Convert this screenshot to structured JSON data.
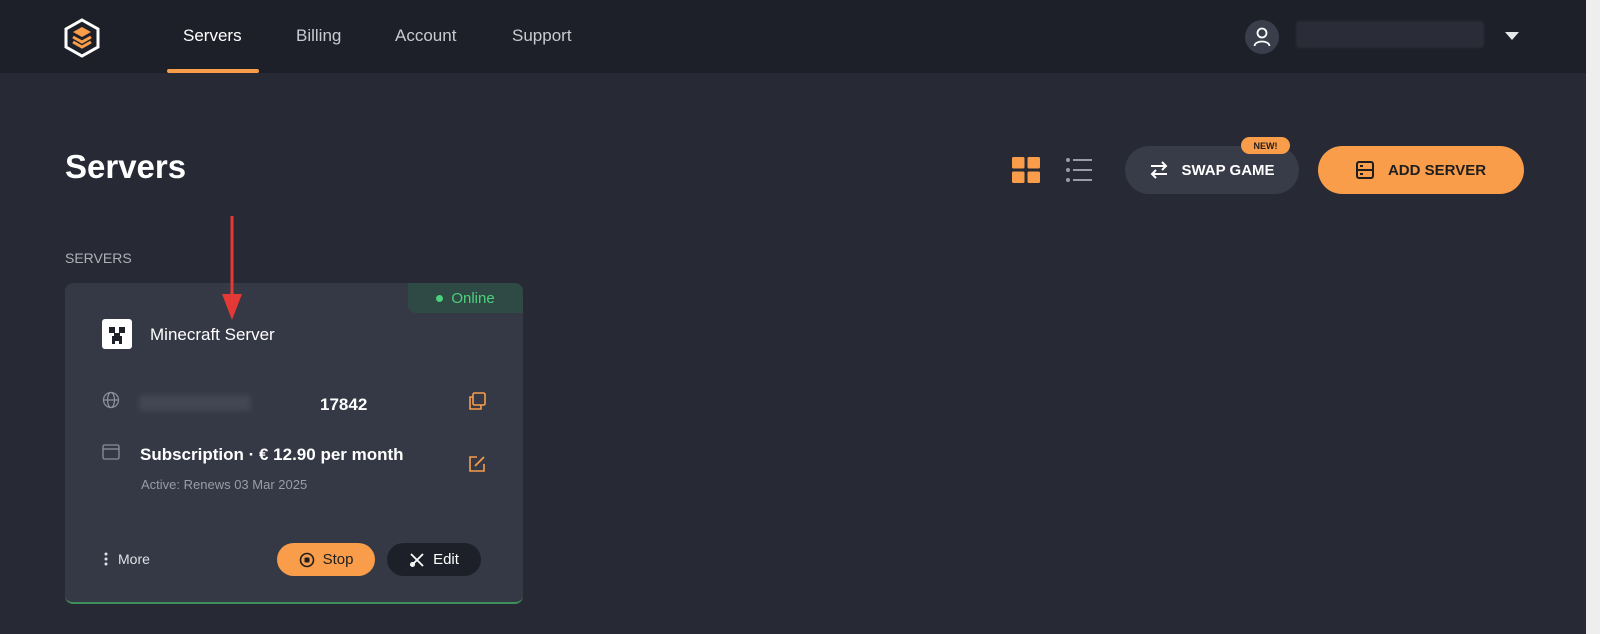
{
  "nav": {
    "items": [
      {
        "label": "Servers",
        "active": true
      },
      {
        "label": "Billing"
      },
      {
        "label": "Account"
      },
      {
        "label": "Support"
      }
    ],
    "user_icon": "user-icon",
    "caret_icon": "chevron-down-icon"
  },
  "header": {
    "title": "Servers",
    "view_icons": [
      "grid-view-icon",
      "list-view-icon"
    ],
    "swap_label": "SWAP GAME",
    "new_badge": "NEW!",
    "add_label": "ADD SERVER"
  },
  "section": {
    "label": "SERVERS"
  },
  "server_card": {
    "status": "Online",
    "name": "Minecraft Server",
    "port": "17842",
    "subscription": "Subscription · € 12.90 per month",
    "renewal": "Active: Renews 03 Mar 2025",
    "more_label": "More",
    "stop_label": "Stop",
    "edit_label": "Edit"
  },
  "colors": {
    "accent": "#f99d4a",
    "background": "#272a35",
    "topbar": "#1e2029",
    "card": "#353845",
    "online": "#4cd07d",
    "annotation_arrow": "#e53935"
  }
}
